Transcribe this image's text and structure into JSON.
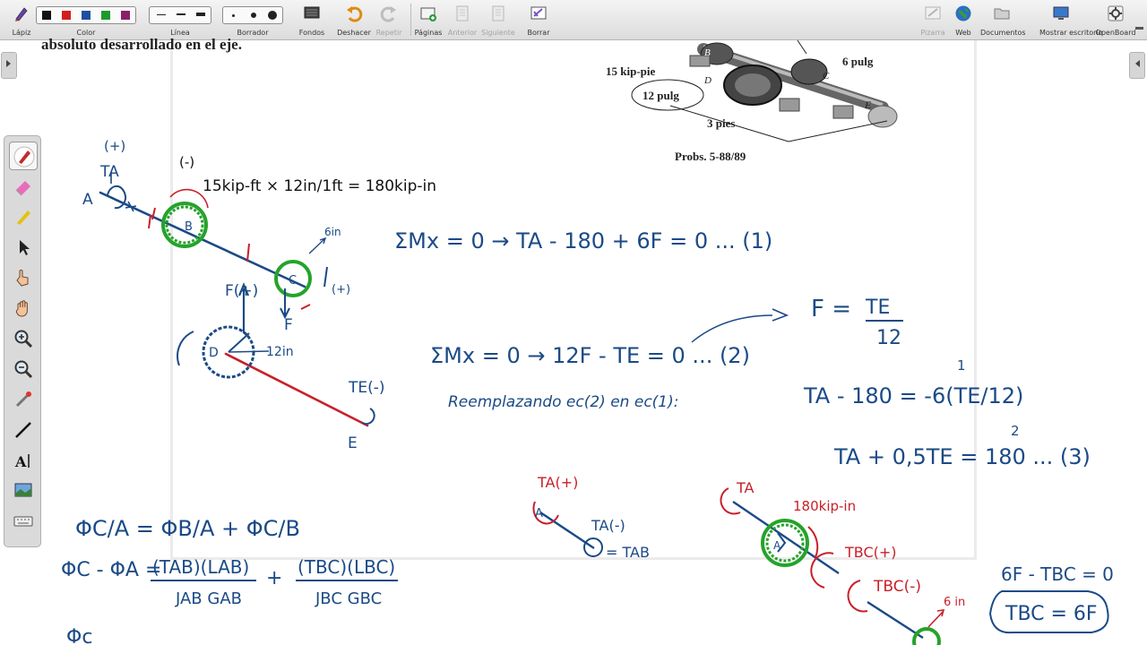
{
  "toolbar": {
    "pen_label": "Lápiz",
    "color_label": "Color",
    "line_label": "Línea",
    "eraser_label": "Borrador",
    "backgrounds_label": "Fondos",
    "undo_label": "Deshacer",
    "redo_label": "Repetir",
    "pages_label": "Páginas",
    "previous_label": "Anterior",
    "next_label": "Siguiente",
    "clear_label": "Borrar",
    "board_label": "Pizarra",
    "web_label": "Web",
    "documents_label": "Documentos",
    "desktop_label": "Mostrar escritorio",
    "openboard_label": "OpenBoard",
    "colors": [
      "#111111",
      "#d11f1f",
      "#1f4f9e",
      "#1d9a2c",
      "#8a1f6a"
    ]
  },
  "page": {
    "top_text": "absoluto desarrollado en el eje."
  },
  "figure": {
    "label_torque": "15 kip-pie",
    "label_12": "12 pulg",
    "label_6": "6 pulg",
    "label_3": "3 pies",
    "caption": "Probs. 5-88/89",
    "label_B": "B",
    "label_D": "D",
    "label_C": "C",
    "label_E": "E"
  },
  "notes": {
    "plus_top": "(+)",
    "TA": "TA",
    "A": "A",
    "minus_B": "(-)",
    "conversion": "15kip-ft × 12in/1ft = 180kip-in",
    "B": "B",
    "six_in": "6in",
    "F_plus": "F(+)",
    "C": "C",
    "plus_C": "(+)",
    "F_lower": "F",
    "D": "D",
    "twelve_in": "12in",
    "TE_minus": "TE(-)",
    "E": "E",
    "eq1": "ΣMx = 0 → TA - 180 + 6F = 0 ... (1)",
    "F_eq": "F =",
    "TE_num": "TE",
    "twelve_den": "12",
    "eq2": "ΣMx = 0 → 12F - TE = 0 ... (2)",
    "replacing": "Reemplazando ec(2) en ec(1):",
    "sub_eq": "TA - 180 = -6(TE/12)",
    "one_above": "1",
    "two_below": "2",
    "eq3": "TA + 0,5TE = 180 ... (3)",
    "phi1": "ΦC/A = ΦB/A + ΦC/B",
    "phi2a": "ΦC - ΦA =",
    "frac1_num": "(TAB)(LAB)",
    "frac1_den": "JAB GAB",
    "plus_sign": "+",
    "frac2_num": "(TBC)(LBC)",
    "frac2_den": "JBC GBC",
    "phi_bottom": "Φc",
    "fbd1_TA": "TA(+)",
    "fbd1_A": "A",
    "fbd1_TA2": "TA(-)",
    "fbd1_eq": "= TAB",
    "fbd2_TA": "TA",
    "fbd2_torque": "180kip-in",
    "fbd2_A": "A",
    "fbd2_TBC": "TBC(+)",
    "fbd3_TBC": "TBC(-)",
    "fbd3_6in": "6 in",
    "eq_tbc1": "6F - TBC = 0",
    "eq_tbc2": "TBC = 6F"
  }
}
